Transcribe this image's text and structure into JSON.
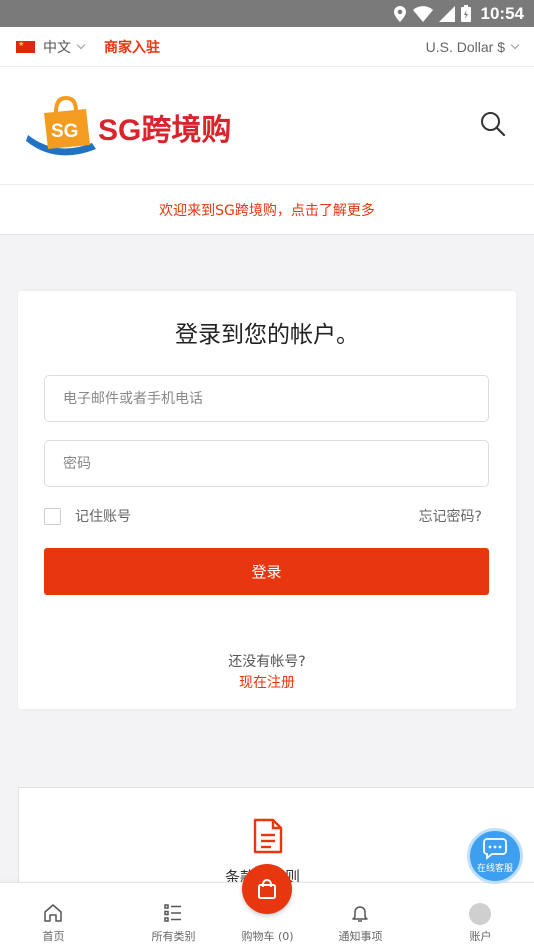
{
  "status_bar": {
    "time": "10:54"
  },
  "topbar": {
    "language": "中文",
    "merchant_link": "商家入驻",
    "currency": "U.S. Dollar $"
  },
  "header": {
    "logo_badge": "SG",
    "logo_text": "SG跨境购"
  },
  "welcome": {
    "text": "欢迎来到SG跨境购，点击了解更多"
  },
  "login": {
    "title": "登录到您的帐户。",
    "email_placeholder": "电子邮件或者手机电话",
    "password_placeholder": "密码",
    "remember_label": "记住账号",
    "forgot_label": "忘记密码?",
    "submit_label": "登录",
    "no_account_text": "还没有帐号?",
    "register_label": "现在注册"
  },
  "terms": {
    "label": "条款和细则"
  },
  "bottom_nav": {
    "items": [
      {
        "label": "首页",
        "icon": "home-icon"
      },
      {
        "label": "所有类别",
        "icon": "list-icon"
      },
      {
        "label": "购物车 (0)",
        "icon": "shopping-bag-icon"
      },
      {
        "label": "通知事项",
        "icon": "bell-icon"
      },
      {
        "label": "账户",
        "icon": "avatar-icon"
      }
    ]
  },
  "chat": {
    "label": "在线客服"
  },
  "colors": {
    "accent": "#e8360f",
    "chat": "#3e9ef0"
  }
}
